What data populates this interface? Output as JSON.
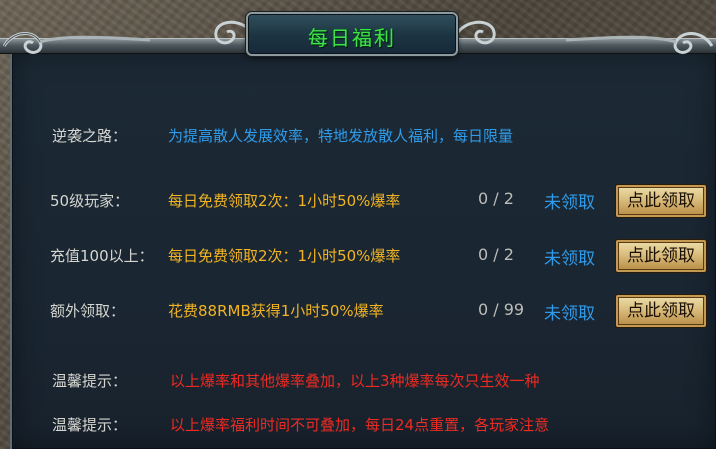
{
  "window": {
    "title": "每日福利"
  },
  "intro": {
    "label": "逆袭之路：",
    "text": "为提高散人发展效率，特地发放散人福利，每日限量"
  },
  "rewards": [
    {
      "label": "50级玩家：",
      "offer": "每日免费领取2次：1小时50%爆率",
      "count": "0 / 2",
      "status": "未领取",
      "button": "点此领取"
    },
    {
      "label": "充值100以上：",
      "offer": "每日免费领取2次：1小时50%爆率",
      "count": "0 / 2",
      "status": "未领取",
      "button": "点此领取"
    },
    {
      "label": "额外领取：",
      "offer": "花费88RMB获得1小时50%爆率",
      "count": "0 / 99",
      "status": "未领取",
      "button": "点此领取"
    }
  ],
  "tips": [
    {
      "label": "温馨提示：",
      "text": "以上爆率和其他爆率叠加，以上3种爆率每次只生效一种"
    },
    {
      "label": "温馨提示：",
      "text": "以上爆率福利时间不可叠加，每日24点重置，各玩家注意"
    }
  ],
  "colors": {
    "title": "#41e243",
    "intro": "#2f9bea",
    "offer": "#f2b422",
    "tip": "#ee2a22",
    "status": "#2f9bea"
  }
}
